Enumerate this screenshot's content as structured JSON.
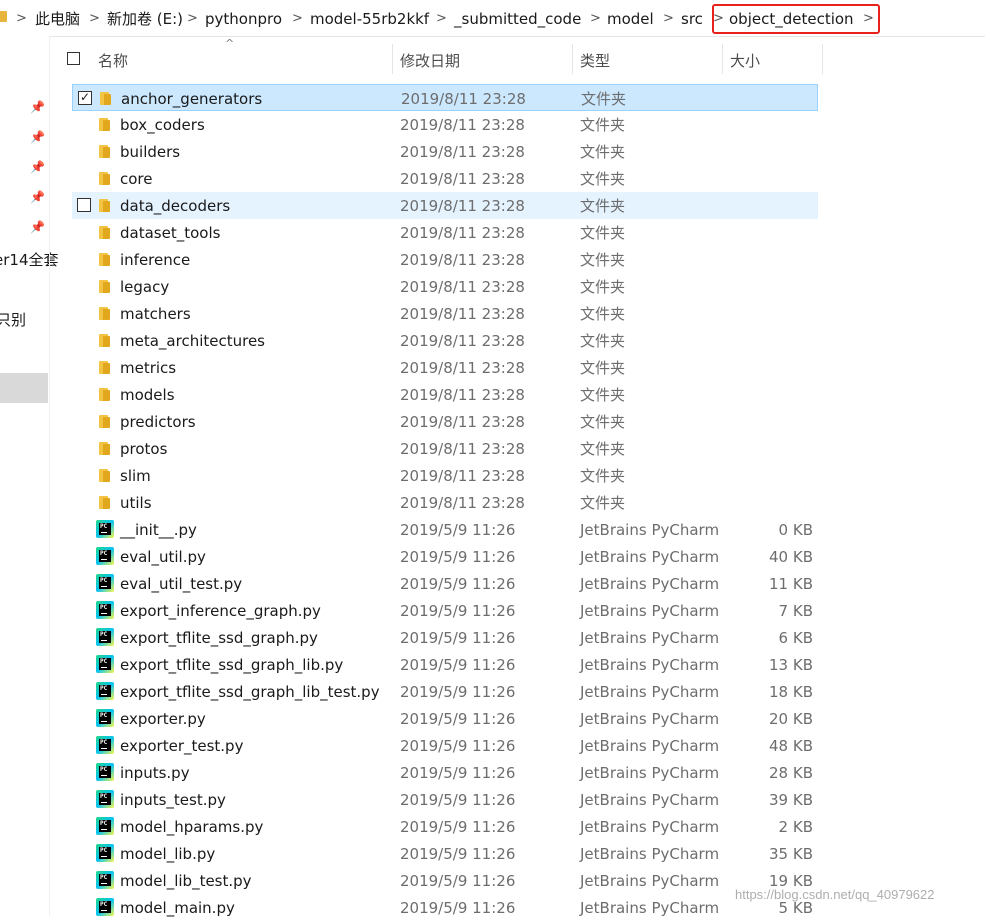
{
  "breadcrumb": {
    "items": [
      "此电脑",
      "新加卷 (E:)",
      "pythonpro",
      "model-55rb2kkf",
      "_submitted_code",
      "model",
      "src",
      "object_detection"
    ]
  },
  "nav": {
    "texts": [
      "er14全套",
      "只别"
    ]
  },
  "columns": {
    "name": "名称",
    "date": "修改日期",
    "type": "类型",
    "size": "大小"
  },
  "files": [
    {
      "name": "anchor_generators",
      "date": "2019/8/11 23:28",
      "type": "文件夹",
      "size": "",
      "kind": "folder"
    },
    {
      "name": "box_coders",
      "date": "2019/8/11 23:28",
      "type": "文件夹",
      "size": "",
      "kind": "folder"
    },
    {
      "name": "builders",
      "date": "2019/8/11 23:28",
      "type": "文件夹",
      "size": "",
      "kind": "folder"
    },
    {
      "name": "core",
      "date": "2019/8/11 23:28",
      "type": "文件夹",
      "size": "",
      "kind": "folder"
    },
    {
      "name": "data_decoders",
      "date": "2019/8/11 23:28",
      "type": "文件夹",
      "size": "",
      "kind": "folder"
    },
    {
      "name": "dataset_tools",
      "date": "2019/8/11 23:28",
      "type": "文件夹",
      "size": "",
      "kind": "folder"
    },
    {
      "name": "inference",
      "date": "2019/8/11 23:28",
      "type": "文件夹",
      "size": "",
      "kind": "folder"
    },
    {
      "name": "legacy",
      "date": "2019/8/11 23:28",
      "type": "文件夹",
      "size": "",
      "kind": "folder"
    },
    {
      "name": "matchers",
      "date": "2019/8/11 23:28",
      "type": "文件夹",
      "size": "",
      "kind": "folder"
    },
    {
      "name": "meta_architectures",
      "date": "2019/8/11 23:28",
      "type": "文件夹",
      "size": "",
      "kind": "folder"
    },
    {
      "name": "metrics",
      "date": "2019/8/11 23:28",
      "type": "文件夹",
      "size": "",
      "kind": "folder"
    },
    {
      "name": "models",
      "date": "2019/8/11 23:28",
      "type": "文件夹",
      "size": "",
      "kind": "folder"
    },
    {
      "name": "predictors",
      "date": "2019/8/11 23:28",
      "type": "文件夹",
      "size": "",
      "kind": "folder"
    },
    {
      "name": "protos",
      "date": "2019/8/11 23:28",
      "type": "文件夹",
      "size": "",
      "kind": "folder"
    },
    {
      "name": "slim",
      "date": "2019/8/11 23:28",
      "type": "文件夹",
      "size": "",
      "kind": "folder"
    },
    {
      "name": "utils",
      "date": "2019/8/11 23:28",
      "type": "文件夹",
      "size": "",
      "kind": "folder"
    },
    {
      "name": "__init__.py",
      "date": "2019/5/9 11:26",
      "type": "JetBrains PyCharm",
      "size": "0 KB",
      "kind": "py"
    },
    {
      "name": "eval_util.py",
      "date": "2019/5/9 11:26",
      "type": "JetBrains PyCharm",
      "size": "40 KB",
      "kind": "py"
    },
    {
      "name": "eval_util_test.py",
      "date": "2019/5/9 11:26",
      "type": "JetBrains PyCharm",
      "size": "11 KB",
      "kind": "py"
    },
    {
      "name": "export_inference_graph.py",
      "date": "2019/5/9 11:26",
      "type": "JetBrains PyCharm",
      "size": "7 KB",
      "kind": "py"
    },
    {
      "name": "export_tflite_ssd_graph.py",
      "date": "2019/5/9 11:26",
      "type": "JetBrains PyCharm",
      "size": "6 KB",
      "kind": "py"
    },
    {
      "name": "export_tflite_ssd_graph_lib.py",
      "date": "2019/5/9 11:26",
      "type": "JetBrains PyCharm",
      "size": "13 KB",
      "kind": "py"
    },
    {
      "name": "export_tflite_ssd_graph_lib_test.py",
      "date": "2019/5/9 11:26",
      "type": "JetBrains PyCharm",
      "size": "18 KB",
      "kind": "py"
    },
    {
      "name": "exporter.py",
      "date": "2019/5/9 11:26",
      "type": "JetBrains PyCharm",
      "size": "20 KB",
      "kind": "py"
    },
    {
      "name": "exporter_test.py",
      "date": "2019/5/9 11:26",
      "type": "JetBrains PyCharm",
      "size": "48 KB",
      "kind": "py"
    },
    {
      "name": "inputs.py",
      "date": "2019/5/9 11:26",
      "type": "JetBrains PyCharm",
      "size": "28 KB",
      "kind": "py"
    },
    {
      "name": "inputs_test.py",
      "date": "2019/5/9 11:26",
      "type": "JetBrains PyCharm",
      "size": "39 KB",
      "kind": "py"
    },
    {
      "name": "model_hparams.py",
      "date": "2019/5/9 11:26",
      "type": "JetBrains PyCharm",
      "size": "2 KB",
      "kind": "py"
    },
    {
      "name": "model_lib.py",
      "date": "2019/5/9 11:26",
      "type": "JetBrains PyCharm",
      "size": "35 KB",
      "kind": "py"
    },
    {
      "name": "model_lib_test.py",
      "date": "2019/5/9 11:26",
      "type": "JetBrains PyCharm",
      "size": "19 KB",
      "kind": "py"
    },
    {
      "name": "model_main.py",
      "date": "2019/5/9 11:26",
      "type": "JetBrains PyCharm",
      "size": "5 KB",
      "kind": "py"
    }
  ],
  "pycharm_icon_text": "PC",
  "watermark": "https://blog.csdn.net/qq_40979622",
  "colors": {
    "selection": "#cce8ff",
    "hover": "#e5f3ff",
    "highlight_box": "#e8221b",
    "folder": "#f3c343"
  }
}
